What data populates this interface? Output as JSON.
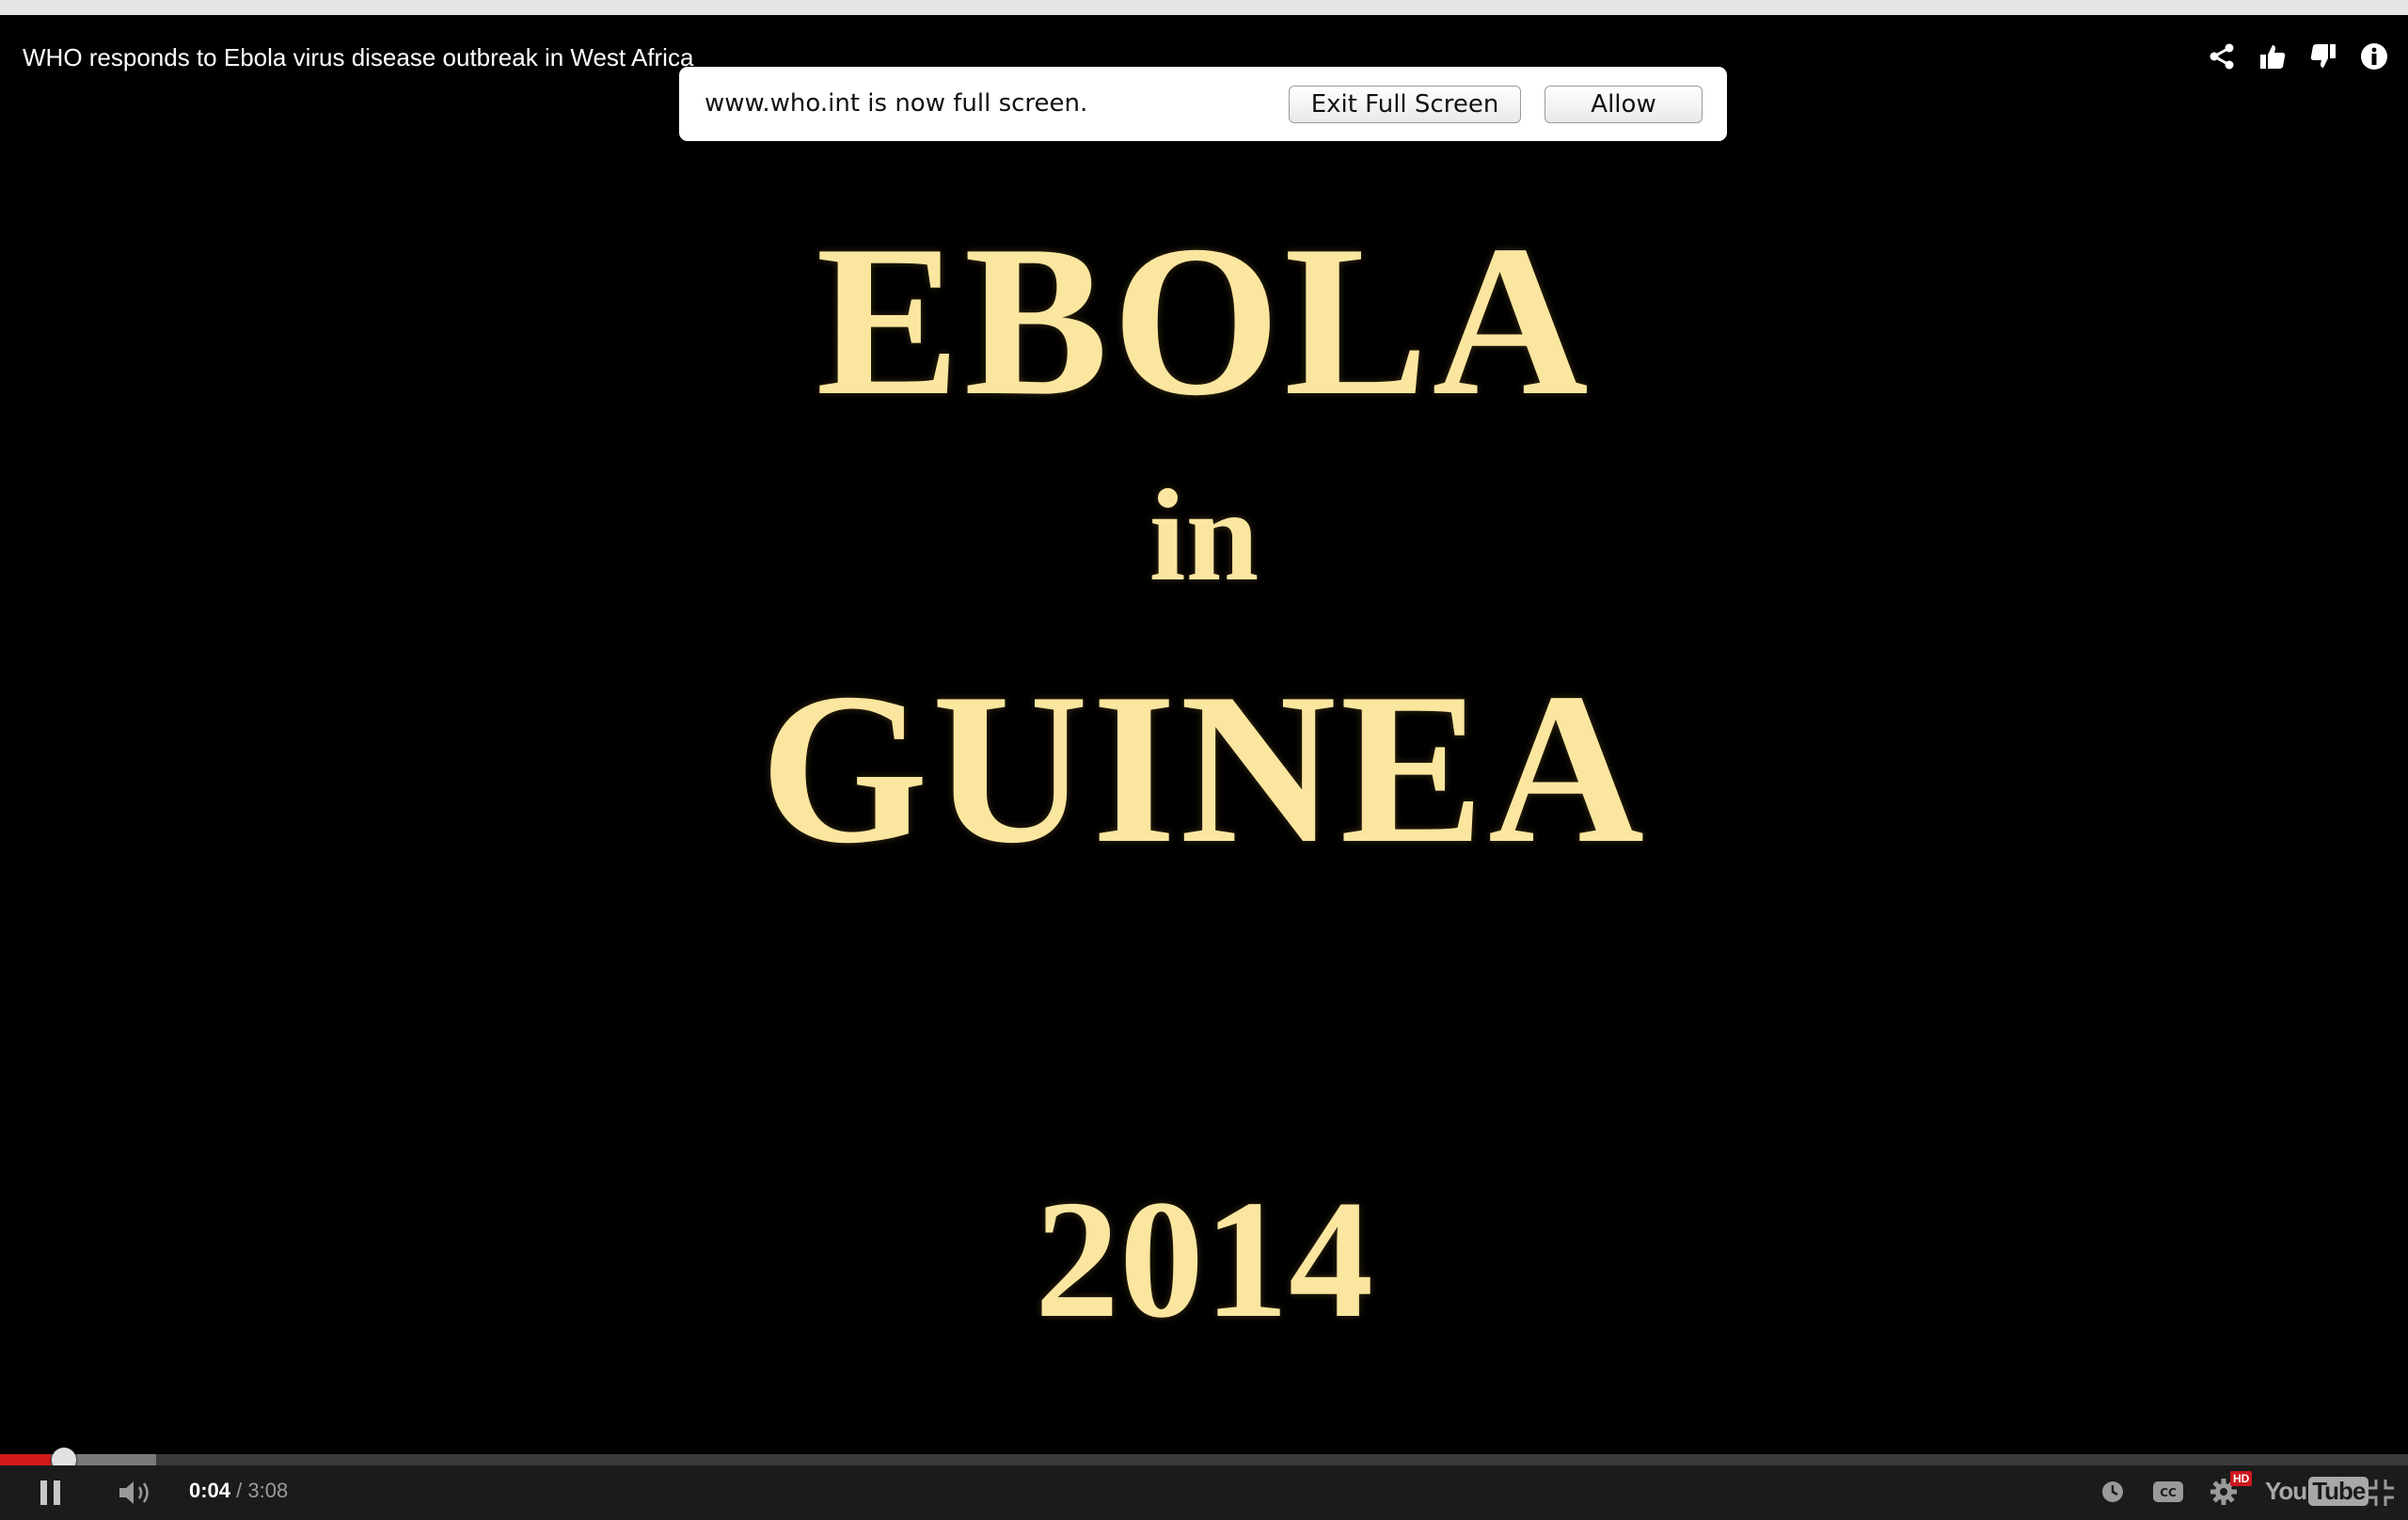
{
  "video": {
    "title": "WHO responds to Ebola virus disease outbreak in West Africa",
    "frame_text": {
      "line1": "EBOLA",
      "line2": "in",
      "line3": "GUINEA",
      "line4": "2014"
    }
  },
  "fullscreen_notice": {
    "message": "www.who.int is now full screen.",
    "exit_label": "Exit Full Screen",
    "allow_label": "Allow"
  },
  "top_actions": {
    "icons": [
      "share-icon",
      "thumbs-up-icon",
      "thumbs-down-icon",
      "info-icon"
    ]
  },
  "controls": {
    "current_time": "0:04",
    "separator": " / ",
    "duration": "3:08",
    "played_fraction": 0.021,
    "buffered_fraction": 0.065,
    "logo": {
      "you": "You",
      "tube": "Tube"
    },
    "hd_badge": "HD",
    "icons": [
      "pause-icon",
      "volume-icon",
      "watch-later-icon",
      "captions-icon",
      "settings-icon",
      "exit-fullscreen-icon"
    ]
  },
  "colors": {
    "progress_played": "#d21a1a",
    "frame_text": "#fbe6a0",
    "background": "#000000"
  }
}
